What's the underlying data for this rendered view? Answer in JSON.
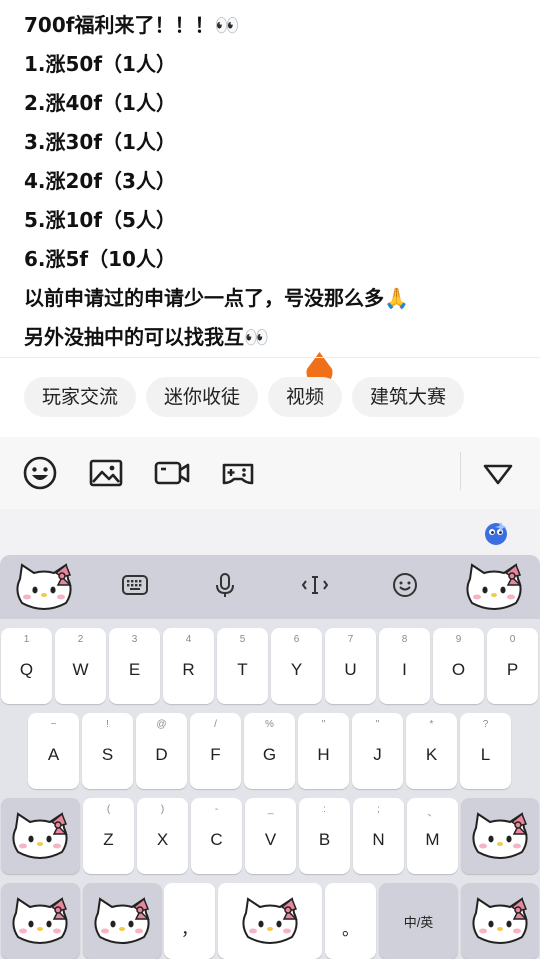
{
  "post": {
    "lines": [
      "700f福利来了！！！👀",
      "1.涨50f（1人）",
      "2.涨40f（1人）",
      "3.涨30f（1人）",
      "4.涨20f（3人）",
      "5.涨10f（5人）",
      "6.涨5f（10人）",
      "以前申请过的申请少一点了，号没那么多🙏",
      "另外没抽中的可以找我互👀"
    ]
  },
  "topics": [
    "玩家交流",
    "迷你收徒",
    "视频",
    "建筑大赛"
  ],
  "toolbar": {
    "icons": [
      "emoji-icon",
      "image-icon",
      "video-camera-icon",
      "gamepad-icon",
      "collapse-triangle-icon"
    ]
  },
  "keyboard": {
    "toolbar_icons": [
      "keyboard-icon",
      "microphone-icon",
      "cursor-move-icon",
      "smiley-icon"
    ],
    "row1": [
      {
        "hint": "1",
        "key": "Q"
      },
      {
        "hint": "2",
        "key": "W"
      },
      {
        "hint": "3",
        "key": "E"
      },
      {
        "hint": "4",
        "key": "R"
      },
      {
        "hint": "5",
        "key": "T"
      },
      {
        "hint": "6",
        "key": "Y"
      },
      {
        "hint": "7",
        "key": "U"
      },
      {
        "hint": "8",
        "key": "I"
      },
      {
        "hint": "9",
        "key": "O"
      },
      {
        "hint": "0",
        "key": "P"
      }
    ],
    "row2": [
      {
        "hint": "~",
        "key": "A"
      },
      {
        "hint": "!",
        "key": "S"
      },
      {
        "hint": "@",
        "key": "D"
      },
      {
        "hint": "/",
        "key": "F"
      },
      {
        "hint": "%",
        "key": "G"
      },
      {
        "hint": "\"",
        "key": "H"
      },
      {
        "hint": "\"",
        "key": "J"
      },
      {
        "hint": "*",
        "key": "K"
      },
      {
        "hint": "?",
        "key": "L"
      }
    ],
    "row3": [
      {
        "hint": "(",
        "key": "Z"
      },
      {
        "hint": ")",
        "key": "X"
      },
      {
        "hint": "-",
        "key": "C"
      },
      {
        "hint": "_",
        "key": "V"
      },
      {
        "hint": ":",
        "key": "B"
      },
      {
        "hint": ";",
        "key": "N"
      },
      {
        "hint": "、",
        "key": "M"
      }
    ],
    "comma": "，",
    "period": "。",
    "lang_switch": "中/英",
    "colors": {
      "topbar": "#cfd0d9",
      "body": "#e3e4ea",
      "key": "#ffffff"
    }
  },
  "colors": {
    "cursor": "#f0701a",
    "kitty_bow": "#e8879c"
  }
}
